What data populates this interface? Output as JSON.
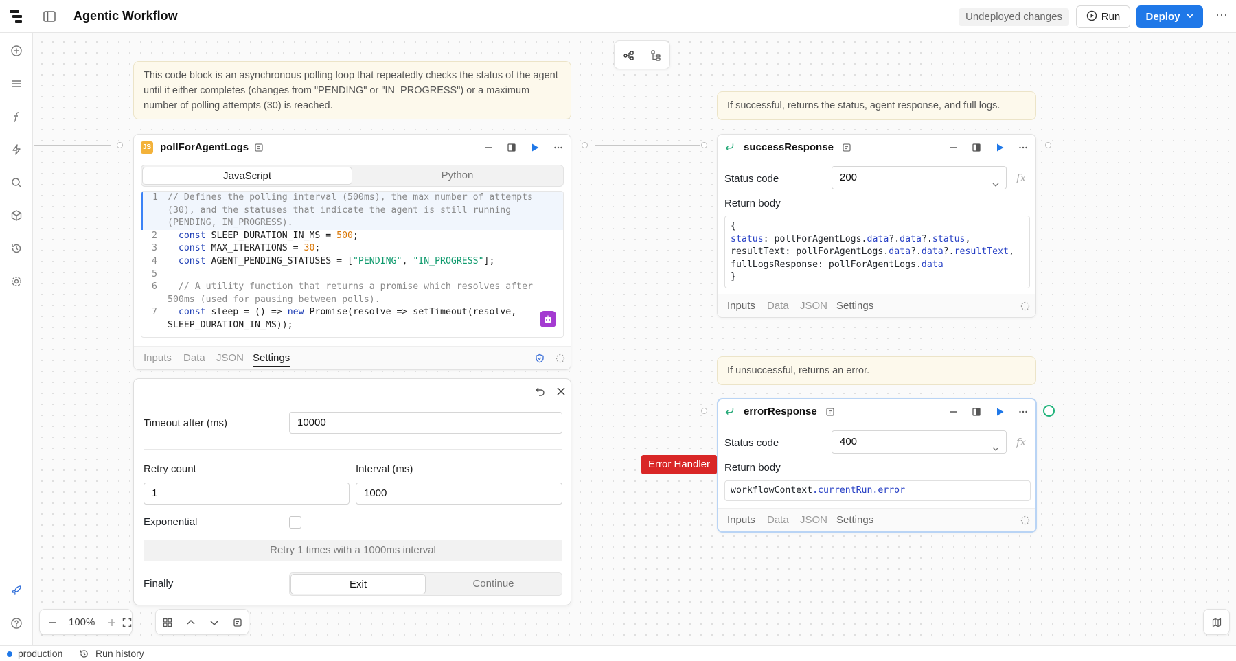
{
  "app": {
    "title": "Agentic Workflow",
    "undeployed_label": "Undeployed changes",
    "run_label": "Run",
    "deploy_label": "Deploy",
    "accent_color": "#1f78e8"
  },
  "leftrail": {
    "icons": [
      "add-icon",
      "list-icon",
      "function-icon",
      "lightning-icon",
      "search-icon",
      "package-icon",
      "history-icon",
      "settings-icon",
      "rocket-icon",
      "help-icon"
    ]
  },
  "notes": {
    "poll_note": "This code block is an asynchronous polling loop that repeatedly checks the status of the agent until it either completes (changes from \"PENDING\" or \"IN_PROGRESS\") or a maximum number of polling attempts (30) is reached.",
    "success_note": "If successful, returns the status, agent response, and full logs.",
    "error_note": "If unsuccessful, returns an error."
  },
  "poll_block": {
    "badge": "JS",
    "title": "pollForAgentLogs",
    "lang_tabs": [
      "JavaScript",
      "Python"
    ],
    "active_lang": "JavaScript",
    "footer_tabs": [
      "Inputs",
      "Data",
      "JSON",
      "Settings"
    ],
    "active_tab": "Settings"
  },
  "success_block": {
    "title": "successResponse",
    "status_code_label": "Status code",
    "status_code_value": "200",
    "return_body_label": "Return body",
    "footer_tabs": [
      "Inputs",
      "Data",
      "JSON",
      "Settings"
    ]
  },
  "error_block": {
    "title": "errorResponse",
    "status_code_label": "Status code",
    "status_code_value": "400",
    "return_body_label": "Return body",
    "return_body_value": "workflowContext.currentRun.error",
    "footer_tabs": [
      "Inputs",
      "Data",
      "JSON",
      "Settings"
    ]
  },
  "settings_panel": {
    "timeout_label": "Timeout after (ms)",
    "timeout_value": "10000",
    "retry_count_label": "Retry count",
    "retry_count_value": "1",
    "interval_label": "Interval (ms)",
    "interval_value": "1000",
    "exponential_label": "Exponential",
    "exponential_checked": false,
    "retry_info": "Retry 1 times with a 1000ms interval",
    "finally_label": "Finally",
    "finally_options": [
      "Exit",
      "Continue"
    ],
    "finally_selected": "Exit"
  },
  "error_handler_label": "Error Handler",
  "zoom": {
    "level": "100%"
  },
  "status_bar": {
    "environment": "production",
    "run_history": "Run history"
  },
  "fx_label": "fx"
}
